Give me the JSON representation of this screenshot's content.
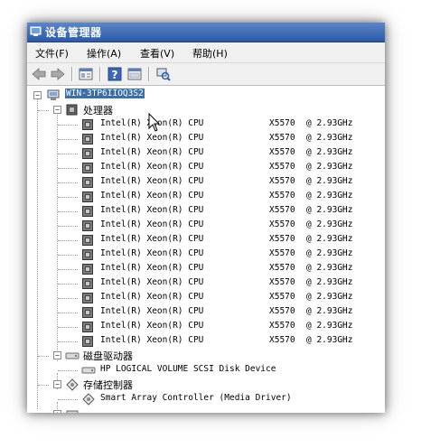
{
  "window": {
    "title": "设备管理器"
  },
  "menu": {
    "items": [
      {
        "label": "文件(F)"
      },
      {
        "label": "操作(A)"
      },
      {
        "label": "查看(V)"
      },
      {
        "label": "帮助(H)"
      }
    ]
  },
  "toolbar": {
    "icons": [
      "back-icon",
      "forward-icon",
      "properties-icon",
      "help-icon",
      "show-hide-icon",
      "scan-hardware-icon"
    ]
  },
  "tree": {
    "root": {
      "label": "WIN-3TP6IIOQ3S2"
    },
    "processors": {
      "label": "处理器",
      "items": [
        {
          "name": "Intel(R) Xeon(R) CPU",
          "model": "X5570",
          "freq": "@ 2.93GHz"
        },
        {
          "name": "Intel(R) Xeon(R) CPU",
          "model": "X5570",
          "freq": "@ 2.93GHz"
        },
        {
          "name": "Intel(R) Xeon(R) CPU",
          "model": "X5570",
          "freq": "@ 2.93GHz"
        },
        {
          "name": "Intel(R) Xeon(R) CPU",
          "model": "X5570",
          "freq": "@ 2.93GHz"
        },
        {
          "name": "Intel(R) Xeon(R) CPU",
          "model": "X5570",
          "freq": "@ 2.93GHz"
        },
        {
          "name": "Intel(R) Xeon(R) CPU",
          "model": "X5570",
          "freq": "@ 2.93GHz"
        },
        {
          "name": "Intel(R) Xeon(R) CPU",
          "model": "X5570",
          "freq": "@ 2.93GHz"
        },
        {
          "name": "Intel(R) Xeon(R) CPU",
          "model": "X5570",
          "freq": "@ 2.93GHz"
        },
        {
          "name": "Intel(R) Xeon(R) CPU",
          "model": "X5570",
          "freq": "@ 2.93GHz"
        },
        {
          "name": "Intel(R) Xeon(R) CPU",
          "model": "X5570",
          "freq": "@ 2.93GHz"
        },
        {
          "name": "Intel(R) Xeon(R) CPU",
          "model": "X5570",
          "freq": "@ 2.93GHz"
        },
        {
          "name": "Intel(R) Xeon(R) CPU",
          "model": "X5570",
          "freq": "@ 2.93GHz"
        },
        {
          "name": "Intel(R) Xeon(R) CPU",
          "model": "X5570",
          "freq": "@ 2.93GHz"
        },
        {
          "name": "Intel(R) Xeon(R) CPU",
          "model": "X5570",
          "freq": "@ 2.93GHz"
        },
        {
          "name": "Intel(R) Xeon(R) CPU",
          "model": "X5570",
          "freq": "@ 2.93GHz"
        },
        {
          "name": "Intel(R) Xeon(R) CPU",
          "model": "X5570",
          "freq": "@ 2.93GHz"
        }
      ]
    },
    "disk_drives": {
      "label": "磁盘驱动器",
      "items": [
        {
          "label": "HP LOGICAL VOLUME SCSI Disk Device"
        }
      ]
    },
    "storage_controllers": {
      "label": "存储控制器",
      "items": [
        {
          "label": "Smart Array Controller (Media Driver)"
        }
      ]
    }
  },
  "colors": {
    "titlebar": "#2c5aa8",
    "selection": "#3a6ea5"
  }
}
